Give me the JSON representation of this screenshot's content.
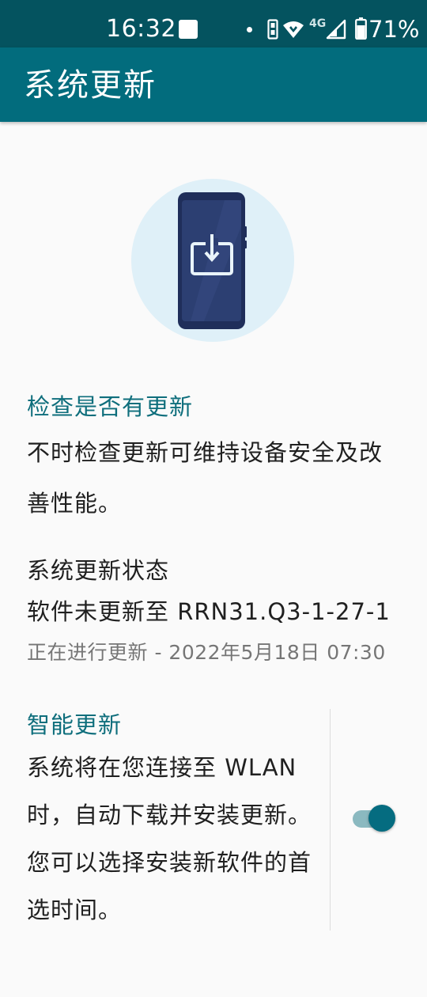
{
  "status_bar": {
    "time": "16:32",
    "network_label": "4G",
    "battery_percent": "71%",
    "icons": [
      "notification-square-icon",
      "dot-icon",
      "sim-icon",
      "wifi-icon",
      "cellular-signal-icon",
      "battery-icon"
    ]
  },
  "app_bar": {
    "title": "系统更新"
  },
  "illustration": {
    "icon": "phone-download-icon"
  },
  "check_update": {
    "heading": "检查是否有更新",
    "description": "不时检查更新可维持设备安全及改善性能。"
  },
  "update_status": {
    "title": "系统更新状态",
    "value": "软件未更新至 RRN31.Q3-1-27-1",
    "progress_note": "正在进行更新 - 2022年5月18日 07:30"
  },
  "smart_update": {
    "heading": "智能更新",
    "description": "系统将在您连接至 WLAN 时，自动下载并安装更新。您可以选择安装新软件的首选时间。",
    "toggle_on": true
  },
  "colors": {
    "status_bar": "#04535f",
    "app_bar": "#026c7d",
    "accent": "#0e6e7c",
    "toggle_thumb": "#056c80",
    "toggle_track": "#8bb9c0",
    "illustration_circle": "#dff0f8",
    "phone_body": "#1f2e5a"
  }
}
